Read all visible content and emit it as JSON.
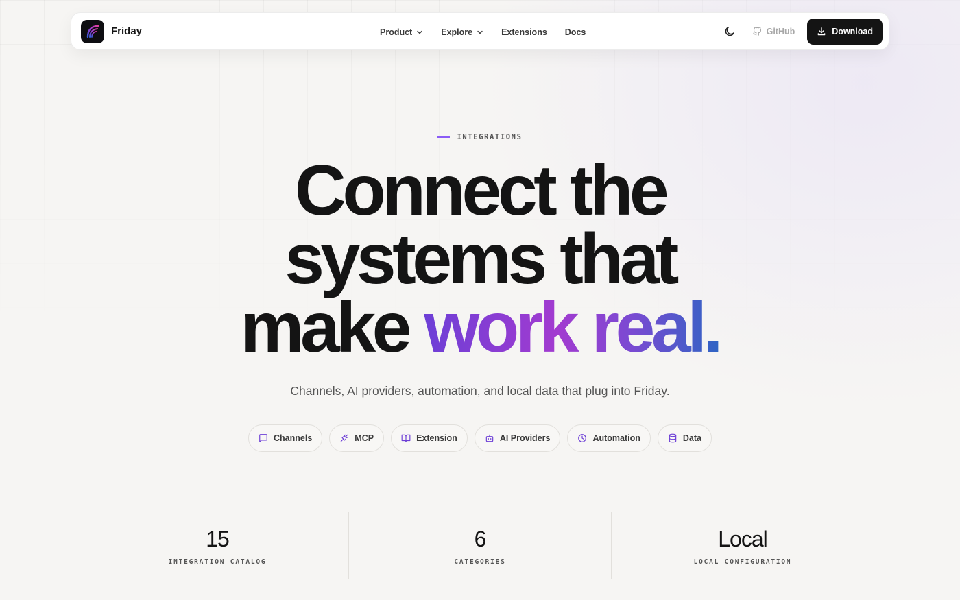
{
  "nav": {
    "brand": "Friday",
    "links": [
      {
        "label": "Product",
        "has_dropdown": true
      },
      {
        "label": "Explore",
        "has_dropdown": true
      },
      {
        "label": "Extensions",
        "has_dropdown": false
      },
      {
        "label": "Docs",
        "has_dropdown": false
      }
    ],
    "github_label": "GitHub",
    "download_label": "Download"
  },
  "hero": {
    "eyebrow": "INTEGRATIONS",
    "headline_line1": "Connect the",
    "headline_line2": "systems that",
    "headline_line3_plain": "make ",
    "headline_line3_accent": "work real.",
    "subtitle": "Channels, AI providers, automation, and local data that plug into Friday."
  },
  "chips": [
    {
      "label": "Channels",
      "icon": "message-square-icon"
    },
    {
      "label": "MCP",
      "icon": "plug-icon"
    },
    {
      "label": "Extension",
      "icon": "book-open-icon"
    },
    {
      "label": "AI Providers",
      "icon": "bot-icon"
    },
    {
      "label": "Automation",
      "icon": "clock-icon"
    },
    {
      "label": "Data",
      "icon": "database-icon"
    }
  ],
  "stats": [
    {
      "value": "15",
      "label": "INTEGRATION CATALOG"
    },
    {
      "value": "6",
      "label": "CATEGORIES"
    },
    {
      "value": "Local",
      "label": "LOCAL CONFIGURATION"
    }
  ],
  "colors": {
    "accent": "#8b5cf6",
    "button_dark": "#141414",
    "background": "#f6f5f3"
  }
}
